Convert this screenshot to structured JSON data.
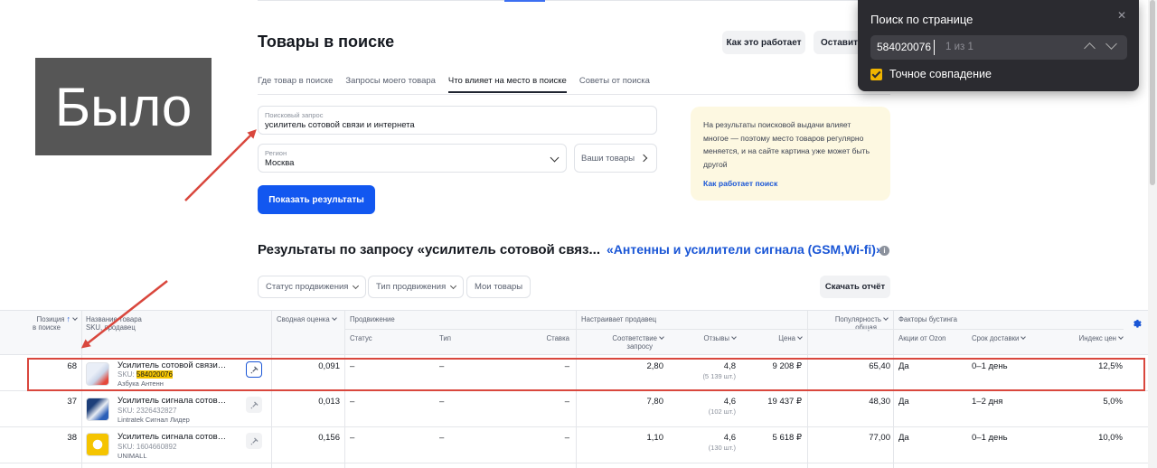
{
  "header": {
    "page_title": "Товары в поиске",
    "how_it_works": "Как это работает",
    "leave_button": "Оставить"
  },
  "tabs": [
    {
      "label": "Где товар в поиске",
      "active": false
    },
    {
      "label": "Запросы моего товара",
      "active": false
    },
    {
      "label": "Что влияет на место в поиске",
      "active": true
    },
    {
      "label": "Советы от поиска",
      "active": false
    }
  ],
  "form": {
    "query_label": "Поисковый запрос",
    "query_value": "усилитель сотовой связи и интернета",
    "region_label": "Регион",
    "region_value": "Москва",
    "your_goods": "Ваши товары",
    "show_results": "Показать результаты"
  },
  "info_card": {
    "text": "На результаты поисковой выдачи влияет многое — поэтому место товаров регулярно меняется, и на сайте картина уже может быть другой",
    "link": "Как работает поиск"
  },
  "results": {
    "title": "Результаты по запросу «усилитель сотовой связ...",
    "category": "«Антенны и усилители сигнала (GSM,Wi-fi)»",
    "info_icon": "i"
  },
  "filters": {
    "promo_status": "Статус продвижения",
    "promo_type": "Тип продвижения",
    "my_goods": "Мои товары",
    "download": "Скачать отчёт"
  },
  "table": {
    "headers": {
      "position_l1": "Позиция",
      "position_l2": "в поиске",
      "name_l1": "Название товара",
      "name_l2": "SKU, продавец",
      "summary": "Сводная оценка",
      "promotion": "Продвижение",
      "status": "Статус",
      "type": "Тип",
      "rate": "Ставка",
      "seller_group": "Настраивает продавец",
      "relevance_l1": "Соответствие",
      "relevance_l2": "запросу",
      "reviews": "Отзывы",
      "price": "Цена",
      "popularity_l1": "Популярность",
      "popularity_l2": "общая",
      "boost_group": "Факторы бустинга",
      "ozon_action": "Акции от Ozon",
      "delivery": "Срок доставки",
      "price_index": "Индекс цен"
    },
    "rows": [
      {
        "position": "68",
        "name": "Усилитель сотовой связи и интернета",
        "sku_label": "SKU:",
        "sku": "584020076",
        "seller": "Азбука Антенн",
        "summary": "0,091",
        "status": "–",
        "type": "–",
        "rate": "–",
        "relevance": "2,80",
        "rating": "4,8",
        "reviews": "(5 139 шт.)",
        "price": "9 208 ₽",
        "popularity": "65,40",
        "ozon_action": "Да",
        "delivery": "0–1 день",
        "price_index": "12,5%"
      },
      {
        "position": "37",
        "name": "Усилитель сигнала сотовой связи",
        "sku_label": "SKU:",
        "sku": "2326432827",
        "seller": "Lintratek Сигнал Лидер",
        "summary": "0,013",
        "status": "–",
        "type": "–",
        "rate": "–",
        "relevance": "7,80",
        "rating": "4,6",
        "reviews": "(102 шт.)",
        "price": "19 437 ₽",
        "popularity": "48,30",
        "ozon_action": "Да",
        "delivery": "1–2 дня",
        "price_index": "5,0%"
      },
      {
        "position": "38",
        "name": "Усилитель сигнала сотовой связи",
        "sku_label": "SKU:",
        "sku": "1604660892",
        "seller": "UNIMALL",
        "summary": "0,156",
        "status": "–",
        "type": "–",
        "rate": "–",
        "relevance": "1,10",
        "rating": "4,6",
        "reviews": "(130 шт.)",
        "price": "5 618 ₽",
        "popularity": "77,00",
        "ozon_action": "Да",
        "delivery": "0–1 день",
        "price_index": "10,0%"
      }
    ]
  },
  "overlay": {
    "bylo": "Было"
  },
  "find_bar": {
    "title": "Поиск по странице",
    "value": "584020076",
    "count": "1 из 1",
    "exact_match": "Точное совпадение",
    "exact_checked": true
  },
  "colors": {
    "accent": "#1257f0",
    "link": "#1a56d6",
    "highlight": "#f7c600",
    "annotation_red": "#d9473d",
    "find_bar_bg": "#2b2b30"
  }
}
